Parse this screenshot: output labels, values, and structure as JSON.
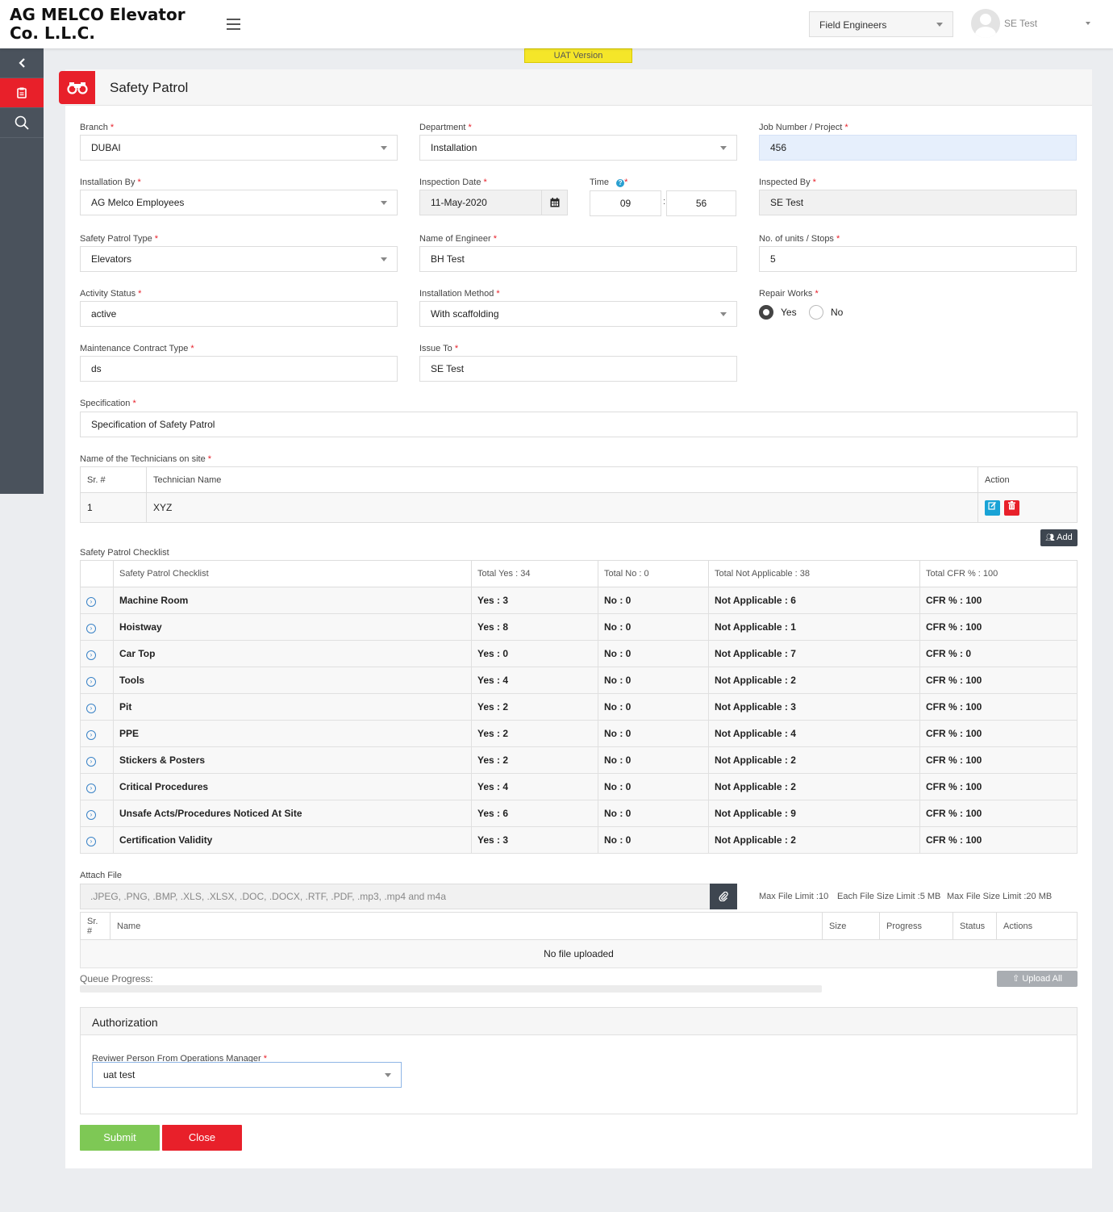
{
  "header": {
    "brand": "AG MELCO Elevator Co. L.L.C.",
    "role": "Field Engineers",
    "user": "SE Test"
  },
  "uat_label": "UAT Version",
  "page_title": "Safety Patrol",
  "form": {
    "branch": {
      "label": "Branch",
      "value": "DUBAI"
    },
    "department": {
      "label": "Department",
      "value": "Installation"
    },
    "job_number": {
      "label": "Job Number / Project",
      "value": "456"
    },
    "installation_by": {
      "label": "Installation By",
      "value": "AG Melco Employees"
    },
    "inspection_date": {
      "label": "Inspection Date",
      "value": "11-May-2020"
    },
    "time": {
      "label": "Time",
      "hour": "09",
      "minute": "56"
    },
    "inspected_by": {
      "label": "Inspected By",
      "value": "SE Test"
    },
    "patrol_type": {
      "label": "Safety Patrol Type",
      "value": "Elevators"
    },
    "engineer": {
      "label": "Name of Engineer",
      "value": "BH Test"
    },
    "units": {
      "label": "No. of units / Stops",
      "value": "5"
    },
    "activity_status": {
      "label": "Activity Status",
      "value": "active"
    },
    "installation_method": {
      "label": "Installation Method",
      "value": "With scaffolding"
    },
    "repair_works": {
      "label": "Repair Works",
      "yes": "Yes",
      "no": "No",
      "selected": "Yes"
    },
    "contract_type": {
      "label": "Maintenance Contract Type",
      "value": "ds"
    },
    "issue_to": {
      "label": "Issue To",
      "value": "SE Test"
    },
    "specification": {
      "label": "Specification",
      "value": "Specification of Safety Patrol"
    }
  },
  "technicians": {
    "label": "Name of the Technicians on site",
    "headers": [
      "Sr. #",
      "Technician Name",
      "Action"
    ],
    "rows": [
      {
        "sr": "1",
        "name": "XYZ"
      }
    ],
    "add_label": "Add"
  },
  "checklist": {
    "label": "Safety Patrol Checklist",
    "headers": [
      "Safety Patrol Checklist",
      "Total Yes : 34",
      "Total No : 0",
      "Total Not Applicable : 38",
      "Total CFR % : 100"
    ],
    "rows": [
      {
        "name": "Machine Room",
        "yes": "Yes : 3",
        "no": "No : 0",
        "na": "Not Applicable : 6",
        "cfr": "CFR % : 100"
      },
      {
        "name": "Hoistway",
        "yes": "Yes : 8",
        "no": "No : 0",
        "na": "Not Applicable : 1",
        "cfr": "CFR % : 100"
      },
      {
        "name": "Car Top",
        "yes": "Yes : 0",
        "no": "No : 0",
        "na": "Not Applicable : 7",
        "cfr": "CFR % : 0"
      },
      {
        "name": "Tools",
        "yes": "Yes : 4",
        "no": "No : 0",
        "na": "Not Applicable : 2",
        "cfr": "CFR % : 100"
      },
      {
        "name": "Pit",
        "yes": "Yes : 2",
        "no": "No : 0",
        "na": "Not Applicable : 3",
        "cfr": "CFR % : 100"
      },
      {
        "name": "PPE",
        "yes": "Yes : 2",
        "no": "No : 0",
        "na": "Not Applicable : 4",
        "cfr": "CFR % : 100"
      },
      {
        "name": "Stickers & Posters",
        "yes": "Yes : 2",
        "no": "No : 0",
        "na": "Not Applicable : 2",
        "cfr": "CFR % : 100"
      },
      {
        "name": "Critical Procedures",
        "yes": "Yes : 4",
        "no": "No : 0",
        "na": "Not Applicable : 2",
        "cfr": "CFR % : 100"
      },
      {
        "name": "Unsafe Acts/Procedures Noticed At Site",
        "yes": "Yes : 6",
        "no": "No : 0",
        "na": "Not Applicable : 9",
        "cfr": "CFR % : 100"
      },
      {
        "name": "Certification Validity",
        "yes": "Yes : 3",
        "no": "No : 0",
        "na": "Not Applicable : 2",
        "cfr": "CFR % : 100"
      }
    ]
  },
  "attach": {
    "label": "Attach File",
    "placeholder": ".JPEG, .PNG, .BMP, .XLS, .XLSX, .DOC, .DOCX, .RTF, .PDF, .mp3, .mp4 and m4a",
    "max_file_limit": "Max File Limit :10",
    "each_size_limit": "Each File Size Limit :5 MB",
    "max_size_limit": "Max File Size Limit :20 MB",
    "headers": [
      "Sr. #",
      "Name",
      "Size",
      "Progress",
      "Status",
      "Actions"
    ],
    "empty": "No file uploaded",
    "queue_label": "Queue Progress:",
    "queue_progress": 0,
    "upload_all": "Upload All"
  },
  "authorization": {
    "title": "Authorization",
    "reviewer_label": "Reviwer Person From Operations Manager",
    "reviewer_value": "uat test"
  },
  "buttons": {
    "submit": "Submit",
    "close": "Close"
  },
  "colors": {
    "accent_red": "#e8202a",
    "submit_green": "#7ec855",
    "sidebar": "#4a525c"
  }
}
